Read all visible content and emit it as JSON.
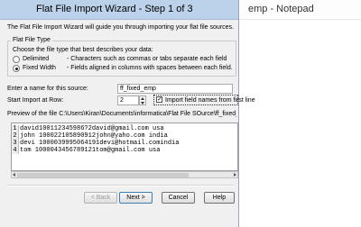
{
  "window": {
    "title": "Flat File Import Wizard - Step 1 of 3"
  },
  "background_window": {
    "title": "emp - Notepad"
  },
  "intro_text": "The Flat File Import Wizard will guide you through importing your flat file sources.",
  "file_type": {
    "group_label": "Flat File Type",
    "instruction": "Choose the file type that best describes your data:",
    "options": [
      {
        "label": "Delimited",
        "description": "- Characters such as commas or tabs separate each field",
        "selected": false
      },
      {
        "label": "Fixed Width",
        "description": "- Fields aligned in columns with spaces between each field.",
        "selected": true
      }
    ]
  },
  "source_name": {
    "label": "Enter a name for this source:",
    "value": "ff_fixed_emp"
  },
  "start_import": {
    "label": "Start Import at Row:",
    "value": "2"
  },
  "import_field_names": {
    "label": "Import field names from first line",
    "checked": true
  },
  "preview": {
    "caption": "Preview of the file C:\\Users\\Kiran\\Documents\\informatica\\Flat File SOurce\\ff_fixed_emp.t",
    "rows": [
      {
        "num": "1",
        "text": "david100112345986?2david@gmail.com   usa"
      },
      {
        "num": "2",
        "text": "john 100022105890912john@yaho.com   india"
      },
      {
        "num": "3",
        "text": "devi 1000039995064191devi@hotmail.comindia"
      },
      {
        "num": "4",
        "text": "tom  1000043456789121tom@gmail.com   usa"
      }
    ]
  },
  "buttons": {
    "back": "< Back",
    "next": "Next >",
    "cancel": "Cancel",
    "help": "Help"
  },
  "colors": {
    "titlebar": "#bcd1ea",
    "dialog_bg": "#f0f0f0"
  }
}
